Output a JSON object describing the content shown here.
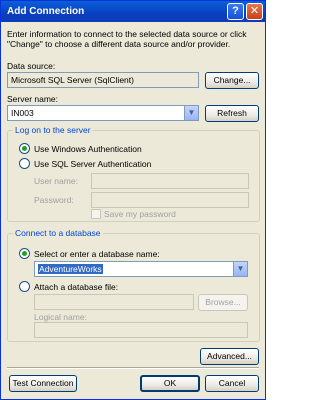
{
  "window": {
    "title": "Add Connection"
  },
  "intro_text": {
    "line1": "Enter information to connect to the selected data source or click",
    "line2": "\"Change\" to choose a different data source and/or provider."
  },
  "data_source": {
    "label": "Data source:",
    "value": "Microsoft SQL Server (SqlClient)",
    "change_button": "Change..."
  },
  "server_name": {
    "label": "Server name:",
    "value": "IN003",
    "refresh_button": "Refresh"
  },
  "logon_group": {
    "title": "Log on to the server",
    "windows_auth": "Use Windows Authentication",
    "sql_auth": "Use SQL Server Authentication",
    "selected": "windows",
    "user_name_label": "User name:",
    "password_label": "Password:",
    "save_password_label": "Save my password"
  },
  "database_group": {
    "title": "Connect to a database",
    "select_db_label": "Select or enter a database name:",
    "db_name_value": "AdventureWorks",
    "attach_label": "Attach a database file:",
    "browse_button": "Browse...",
    "logical_name_label": "Logical name:",
    "selected": "select"
  },
  "buttons": {
    "advanced": "Advanced...",
    "test_connection": "Test Connection",
    "ok": "OK",
    "cancel": "Cancel"
  }
}
